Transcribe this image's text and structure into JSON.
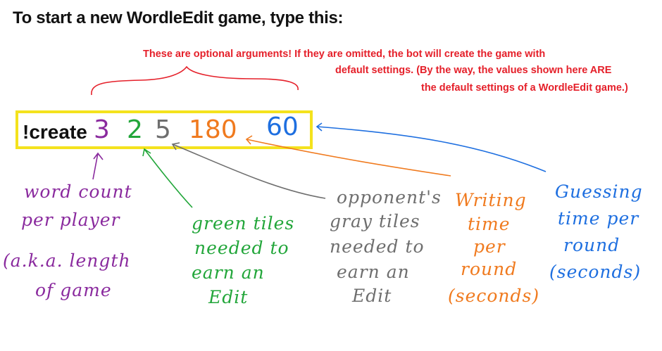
{
  "title": "To start a new WordleEdit game, type this:",
  "note": {
    "line1": "These are optional arguments! If they are omitted, the bot will create the game with",
    "line2": "default settings.  (By the way, the values shown here ARE",
    "line3": "the default settings of a WordleEdit game.)"
  },
  "command": {
    "name": "!create",
    "args": [
      "3",
      "2",
      "5",
      "180",
      "60"
    ]
  },
  "labels": {
    "word_count": [
      "word count",
      "per player",
      "(a.k.a. length",
      "of game"
    ],
    "green_tiles": [
      "green tiles",
      "needed to",
      "earn an",
      "Edit"
    ],
    "gray_tiles": [
      "opponent's",
      "gray tiles",
      "needed to",
      "earn an",
      "Edit"
    ],
    "writing_time": [
      "Writing",
      "time",
      "per",
      "round",
      "(seconds)"
    ],
    "guessing_time": [
      "Guessing",
      "time per",
      "round",
      "(seconds)"
    ]
  },
  "colors": {
    "purple": "#8a2a9e",
    "green": "#22a63a",
    "gray": "#6e6e6e",
    "orange": "#f07a1e",
    "blue": "#1e6fe0",
    "red": "#e5202a",
    "yellow": "#f4e21d"
  }
}
